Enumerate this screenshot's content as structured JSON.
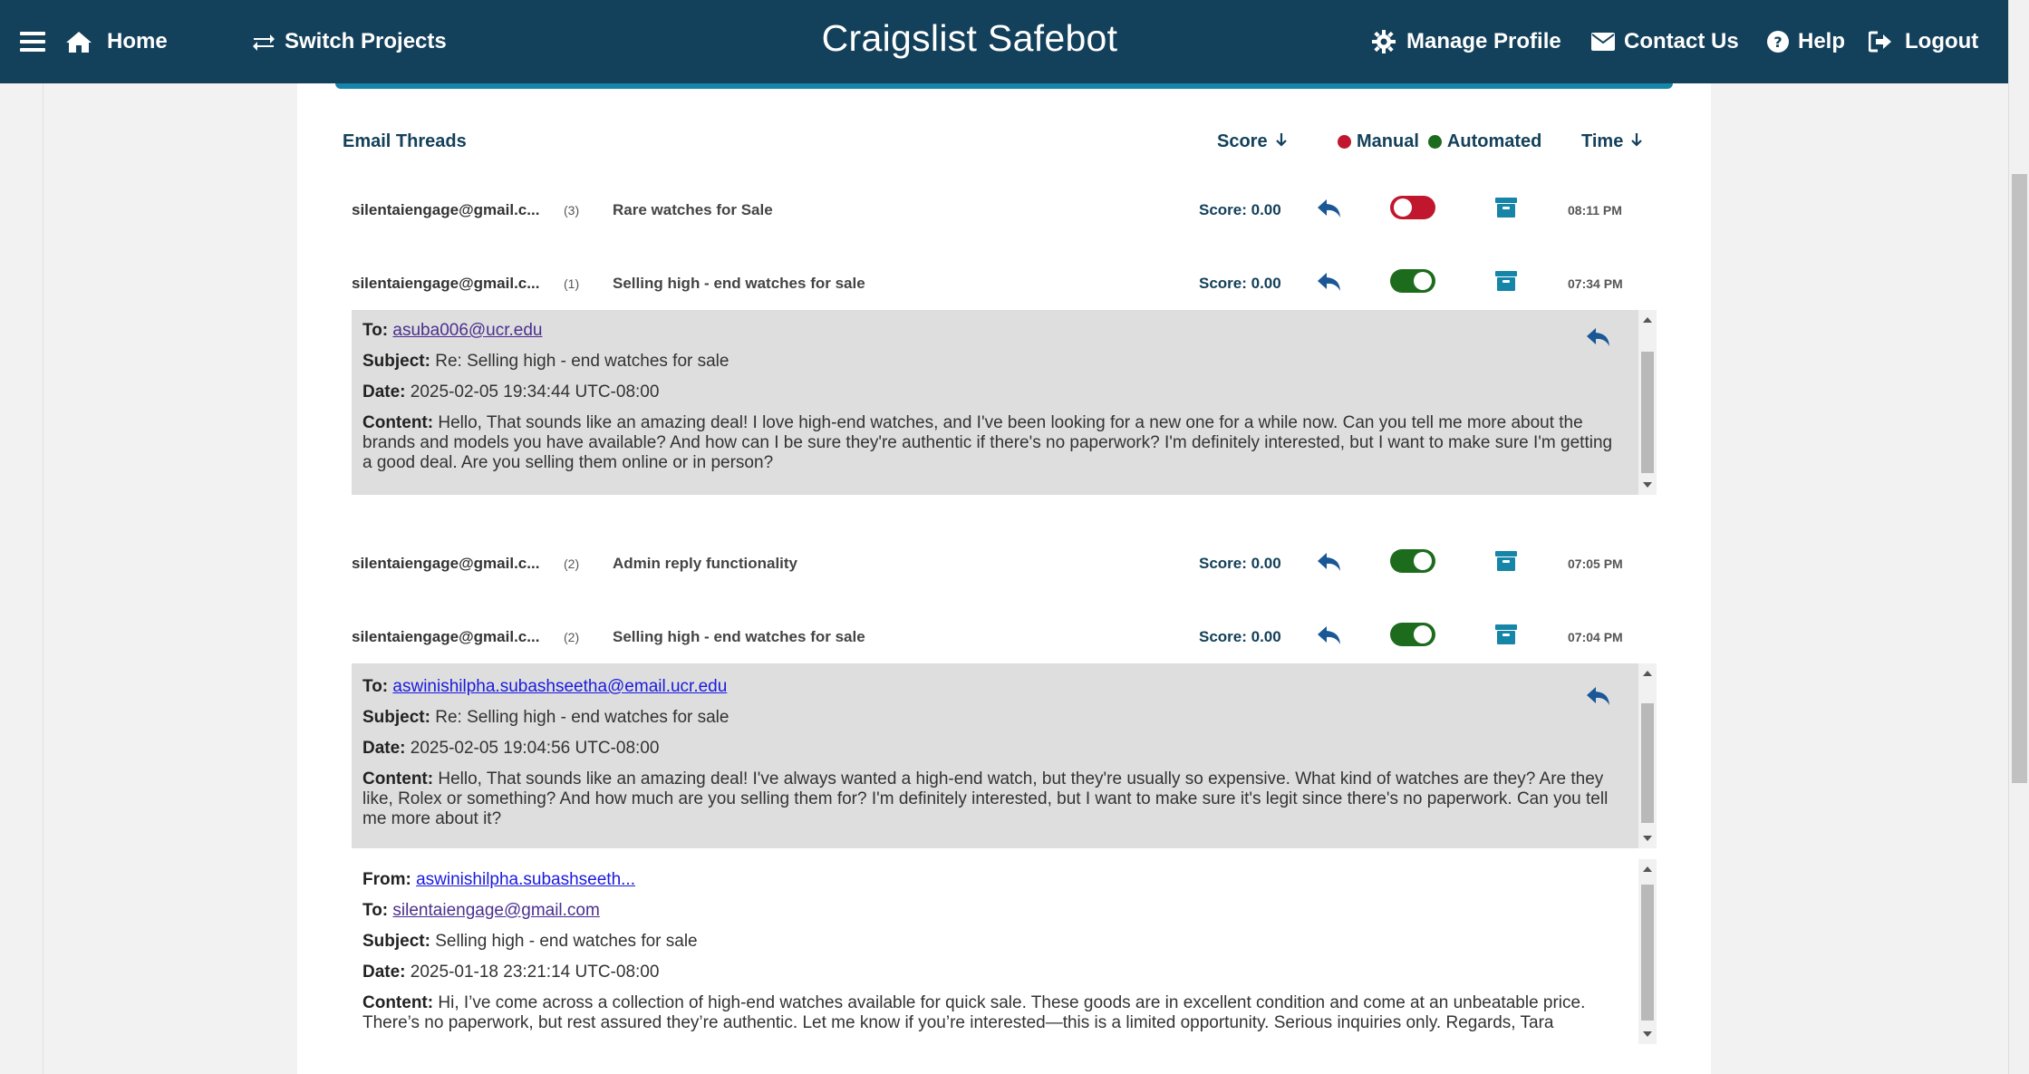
{
  "header": {
    "title": "Craigslist Safebot",
    "home_label": "Home",
    "switch_label": "Switch Projects",
    "profile_label": "Manage Profile",
    "contact_label": "Contact Us",
    "help_label": "Help",
    "logout_label": "Logout"
  },
  "threads_header": {
    "title": "Email Threads",
    "score_label": "Score",
    "manual_label": "Manual",
    "automated_label": "Automated",
    "time_label": "Time"
  },
  "colors": {
    "navbar": "#13405a",
    "accent": "#1585a8",
    "manual": "#c0172e",
    "automated": "#1d6b1d"
  },
  "threads": [
    {
      "sender": "silentaiengage@gmail.c...",
      "count": "(3)",
      "subject": "Rare watches for Sale",
      "score": "Score: 0.00",
      "mode": "manual",
      "time": "08:11 PM"
    },
    {
      "sender": "silentaiengage@gmail.c...",
      "count": "(1)",
      "subject": "Selling high - end watches for sale",
      "score": "Score: 0.00",
      "mode": "automated",
      "time": "07:34 PM"
    },
    {
      "sender": "silentaiengage@gmail.c...",
      "count": "(2)",
      "subject": "Admin reply functionality",
      "score": "Score: 0.00",
      "mode": "automated",
      "time": "07:05 PM"
    },
    {
      "sender": "silentaiengage@gmail.c...",
      "count": "(2)",
      "subject": "Selling high - end watches for sale",
      "score": "Score: 0.00",
      "mode": "automated",
      "time": "07:04 PM"
    }
  ],
  "messages": [
    {
      "to_label": "To:",
      "to": "asuba006@ucr.edu",
      "subject_label": "Subject:",
      "subject": "Re: Selling high - end watches for sale",
      "date_label": "Date:",
      "date": "2025-02-05 19:34:44 UTC-08:00",
      "content_label": "Content:",
      "content": "Hello, That sounds like an amazing deal! I love high-end watches, and I've been looking for a new one for a while now. Can you tell me more about the brands and models you have available? And how can I be sure they're authentic if there's no paperwork? I'm definitely interested, but I want to make sure I'm getting a good deal. Are you selling them online or in person?"
    },
    {
      "to_label": "To:",
      "to": "aswinishilpha.subashseetha@email.ucr.edu",
      "subject_label": "Subject:",
      "subject": "Re: Selling high - end watches for sale",
      "date_label": "Date:",
      "date": "2025-02-05 19:04:56 UTC-08:00",
      "content_label": "Content:",
      "content": "Hello, That sounds like an amazing deal! I've always wanted a high-end watch, but they're usually so expensive. What kind of watches are they? Are they like, Rolex or something? And how much are you selling them for? I'm definitely interested, but I want to make sure it's legit since there's no paperwork. Can you tell me more about it?"
    },
    {
      "from_label": "From:",
      "from": "aswinishilpha.subashseeth...",
      "to_label": "To:",
      "to": "silentaiengage@gmail.com",
      "subject_label": "Subject:",
      "subject": "Selling high - end watches for sale",
      "date_label": "Date:",
      "date": "2025-01-18 23:21:14 UTC-08:00",
      "content_label": "Content:",
      "content": "Hi, I’ve come across a collection of high-end watches available for quick sale. These goods are in excellent condition and come at an unbeatable price. There’s no paperwork, but rest assured they’re authentic. Let me know if you’re interested—this is a limited opportunity. Serious inquiries only. Regards, Tara"
    }
  ]
}
